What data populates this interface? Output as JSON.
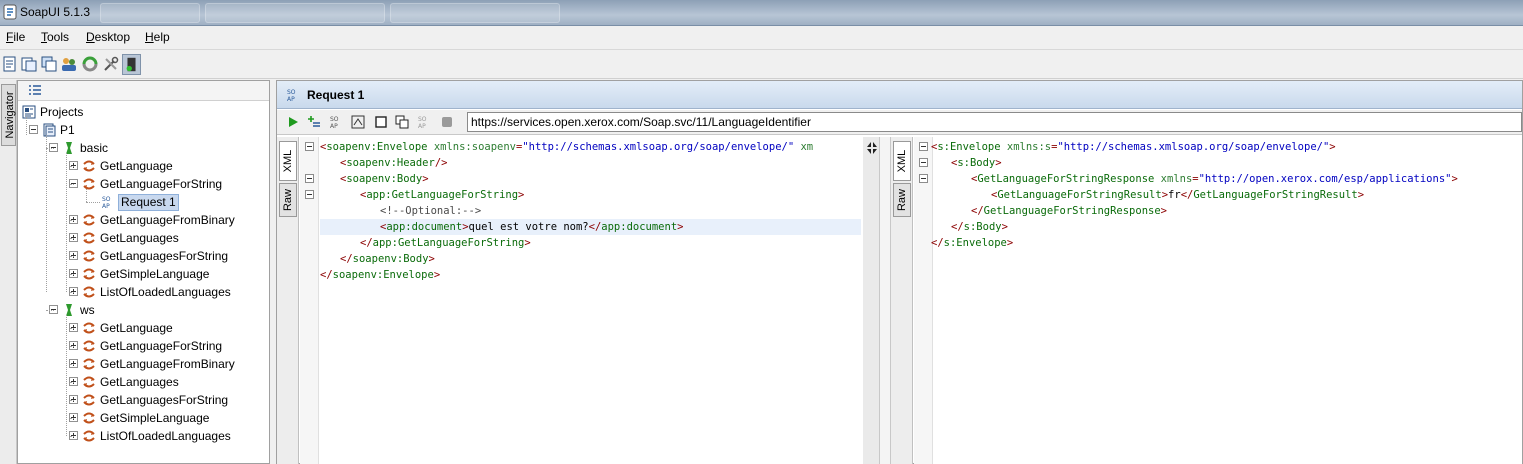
{
  "window": {
    "title": "SoapUI 5.1.3"
  },
  "menu": [
    {
      "label": "File",
      "mnemonic": "F",
      "rest": "ile"
    },
    {
      "label": "Tools",
      "mnemonic": "T",
      "rest": "ools"
    },
    {
      "label": "Desktop",
      "mnemonic": "D",
      "rest": "esktop"
    },
    {
      "label": "Help",
      "mnemonic": "H",
      "rest": "elp"
    }
  ],
  "toolbar": {
    "icons": [
      "new-project-icon",
      "import-project-icon",
      "save-all-icon",
      "forum-icon",
      "trial-icon",
      "preferences-icon",
      "proxy-icon"
    ]
  },
  "navigator": {
    "label": "Navigator"
  },
  "tree": {
    "root": "Projects",
    "project": "P1",
    "interfaces": [
      {
        "name": "basic",
        "operations": [
          "GetLanguage",
          "GetLanguageForString",
          "GetLanguageFromBinary",
          "GetLanguages",
          "GetLanguagesForString",
          "GetSimpleLanguage",
          "ListOfLoadedLanguages"
        ],
        "request": "Request 1"
      },
      {
        "name": "ws",
        "operations": [
          "GetLanguage",
          "GetLanguageForString",
          "GetLanguageFromBinary",
          "GetLanguages",
          "GetLanguagesForString",
          "GetSimpleLanguage",
          "ListOfLoadedLanguages"
        ]
      }
    ]
  },
  "request": {
    "title": "Request 1",
    "url": "https://services.open.xerox.com/Soap.svc/11/LanguageIdentifier",
    "tabs": {
      "xml": "XML",
      "raw": "Raw"
    },
    "request_xml": {
      "envelope_tag": "soapenv:Envelope",
      "envelope_attr": "xmlns:soapenv",
      "envelope_val": "\"http://schemas.xmlsoap.org/soap/envelope/\"",
      "envelope_trail": "xm",
      "header_tag": "soapenv:Header",
      "body_tag": "soapenv:Body",
      "op_tag": "app:GetLanguageForString",
      "comment": "<!--Optional:-->",
      "doc_tag": "app:document",
      "doc_text": "quel est votre nom?"
    },
    "response_xml": {
      "envelope_tag": "s:Envelope",
      "envelope_attr": "xmlns:s",
      "envelope_val": "\"http://schemas.xmlsoap.org/soap/envelope/\"",
      "body_tag": "s:Body",
      "resp_tag": "GetLanguageForStringResponse",
      "resp_attr": "xmlns",
      "resp_val": "\"http://open.xerox.com/esp/applications\"",
      "result_tag": "GetLanguageForStringResult",
      "result_text": "fr"
    }
  }
}
